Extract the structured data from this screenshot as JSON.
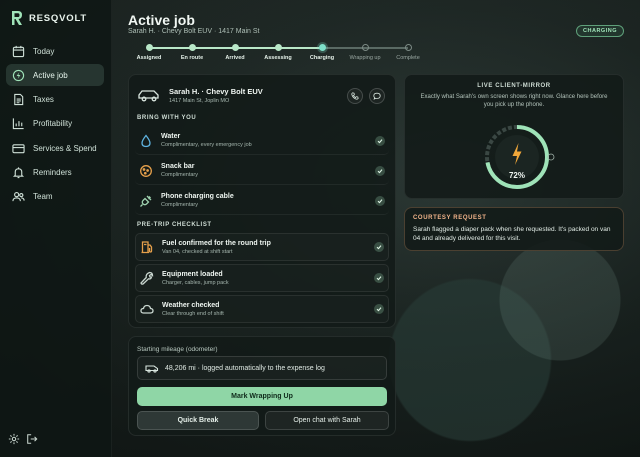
{
  "brand": {
    "name": "RESQVOLT"
  },
  "sidebar": {
    "items": [
      {
        "label": "Today",
        "icon": "calendar-icon",
        "active": false
      },
      {
        "label": "Active job",
        "icon": "bolt-icon",
        "active": true
      },
      {
        "label": "Taxes",
        "icon": "document-icon",
        "active": false
      },
      {
        "label": "Profitability",
        "icon": "chart-icon",
        "active": false
      },
      {
        "label": "Services & Spend",
        "icon": "card-icon",
        "active": false
      },
      {
        "label": "Reminders",
        "icon": "bell-icon",
        "active": false
      },
      {
        "label": "Team",
        "icon": "team-icon",
        "active": false
      }
    ],
    "footer_icons": [
      "gear-icon",
      "logout-icon"
    ]
  },
  "header": {
    "title": "Active job",
    "subtitle": "Sarah H. · Chevy Bolt EUV · 1417 Main St",
    "status": "CHARGING"
  },
  "stepper": {
    "steps": [
      {
        "label": "Assigned",
        "state": "done"
      },
      {
        "label": "En route",
        "state": "done"
      },
      {
        "label": "Arrived",
        "state": "done"
      },
      {
        "label": "Assessing",
        "state": "done"
      },
      {
        "label": "Charging",
        "state": "current"
      },
      {
        "label": "Wrapping up",
        "state": "todo"
      },
      {
        "label": "Complete",
        "state": "todo"
      }
    ]
  },
  "job": {
    "vehicle_name": "Sarah H. · Chevy Bolt EUV",
    "vehicle_address": "1417 Main St, Joplin MO",
    "bring_heading": "BRING WITH YOU",
    "bring_items": [
      {
        "title": "Water",
        "detail": "Complimentary, every emergency job",
        "icon": "water-drop-icon",
        "color": "#5fb3e0"
      },
      {
        "title": "Snack bar",
        "detail": "Complimentary",
        "icon": "cookie-icon",
        "color": "#e6a04b"
      },
      {
        "title": "Phone charging cable",
        "detail": "Complimentary",
        "icon": "plug-icon",
        "color": "#9fd3b0"
      }
    ],
    "checklist_heading": "PRE-TRIP CHECKLIST",
    "checklist_items": [
      {
        "title": "Fuel confirmed for the round trip",
        "detail": "Van 04, checked at shift start",
        "icon": "fuel-icon",
        "color": "#e6a04b"
      },
      {
        "title": "Equipment loaded",
        "detail": "Charger, cables, jump pack",
        "icon": "wrench-icon",
        "color": "#c9d6cf"
      },
      {
        "title": "Weather checked",
        "detail": "Clear through end of shift",
        "icon": "cloud-icon",
        "color": "#c9d6cf"
      }
    ]
  },
  "mileage": {
    "label": "Starting mileage (odometer)",
    "value": "48,206 mi · logged automatically to the expense log",
    "primary_button": "Mark Wrapping Up",
    "quick_break_button": "Quick Break",
    "chat_button": "Open chat with Sarah"
  },
  "mirror": {
    "heading": "LIVE CLIENT-MIRROR",
    "description": "Exactly what Sarah's own screen shows right now. Glance here before you pick up the phone.",
    "charge_percent": 72,
    "charge_label": "72%"
  },
  "courtesy": {
    "heading": "COURTESY REQUEST",
    "text": "Sarah flagged a diaper pack when she requested. It's packed on van 04 and already delivered for this visit."
  },
  "colors": {
    "accent": "#8fd6a6",
    "current_step": "#7ee0c9",
    "warning": "#f2b48a"
  }
}
